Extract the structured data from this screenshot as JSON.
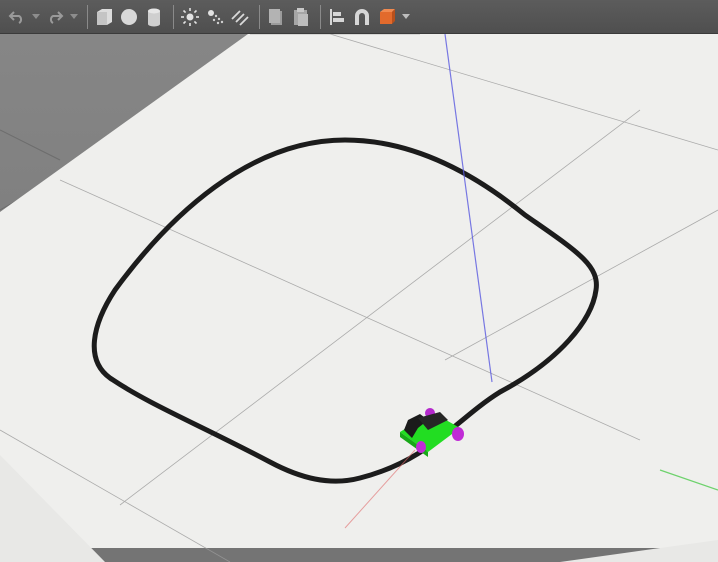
{
  "toolbar": {
    "tools": [
      {
        "icon": "undo-icon"
      },
      {
        "icon": "redo-icon"
      },
      {
        "icon": "box-shape-icon"
      },
      {
        "icon": "sphere-shape-icon"
      },
      {
        "icon": "cylinder-shape-icon"
      },
      {
        "icon": "point-light-icon"
      },
      {
        "icon": "spot-light-icon"
      },
      {
        "icon": "directional-light-icon"
      },
      {
        "icon": "copy-icon"
      },
      {
        "icon": "paste-icon"
      },
      {
        "icon": "align-icon"
      },
      {
        "icon": "snap-magnet-icon"
      },
      {
        "icon": "change-view-icon"
      }
    ]
  },
  "scene": {
    "colors": {
      "background": "#7d7d7d",
      "ground_plane": "#efefed",
      "track_line": "#1c1c1c",
      "robot_body": "#22dd22",
      "robot_wheels": "#c02bd6",
      "axis_z": "#5a5ae0",
      "axis_x": "#e06a6a",
      "axis_y": "#4ecb4e"
    }
  }
}
